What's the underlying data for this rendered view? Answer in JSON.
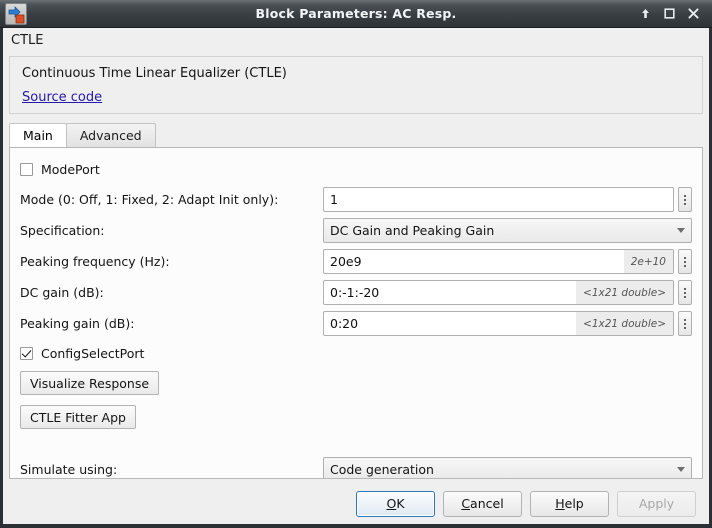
{
  "window": {
    "title": "Block Parameters: AC Resp.",
    "icon": "simulink-block-icon",
    "controls": [
      {
        "name": "restore-up-button",
        "glyph": "up-arrow-icon"
      },
      {
        "name": "maximize-button",
        "glyph": "maximize-icon"
      },
      {
        "name": "close-button",
        "glyph": "close-icon"
      }
    ]
  },
  "subtitle": "CTLE",
  "description": {
    "text": "Continuous Time Linear Equalizer (CTLE)",
    "link_label": "Source code"
  },
  "tabs": [
    {
      "label": "Main",
      "active": true
    },
    {
      "label": "Advanced",
      "active": false
    }
  ],
  "form": {
    "mode_port": {
      "label": "ModePort",
      "checked": false
    },
    "rows": [
      {
        "label": "Mode (0: Off, 1: Fixed, 2: Adapt Init only):",
        "type": "text",
        "value": "1",
        "hint": "",
        "has_dots": true
      },
      {
        "label": "Specification:",
        "type": "combo",
        "value": "DC Gain and Peaking Gain",
        "hint": "",
        "has_dots": false
      },
      {
        "label": "Peaking frequency (Hz):",
        "type": "text",
        "value": "20e9",
        "hint": "2e+10",
        "has_dots": true
      },
      {
        "label": "DC gain (dB):",
        "type": "text",
        "value": "0:-1:-20",
        "hint": "<1x21 double>",
        "has_dots": true
      },
      {
        "label": "Peaking gain (dB):",
        "type": "text",
        "value": "0:20",
        "hint": "<1x21 double>",
        "has_dots": true
      }
    ],
    "config_select_port": {
      "label": "ConfigSelectPort",
      "checked": true
    },
    "buttons": [
      {
        "label": "Visualize Response",
        "name": "visualize-response-button"
      },
      {
        "label": "CTLE Fitter App",
        "name": "ctle-fitter-app-button"
      }
    ],
    "simulate_using": {
      "label": "Simulate using:",
      "value": "Code generation"
    }
  },
  "footer": {
    "ok": {
      "pre": "",
      "mnemonic": "O",
      "post": "K"
    },
    "cancel": {
      "pre": "",
      "mnemonic": "C",
      "post": "ancel"
    },
    "help": {
      "pre": "",
      "mnemonic": "H",
      "post": "elp"
    },
    "apply": {
      "label": "Apply"
    }
  },
  "colors": {
    "dialog_bg": "#efefef",
    "panel_bg": "#fcfcfc",
    "link": "#2419a8",
    "focus_border": "#2a79c4",
    "titlebar_text": "#f2f4f6"
  }
}
